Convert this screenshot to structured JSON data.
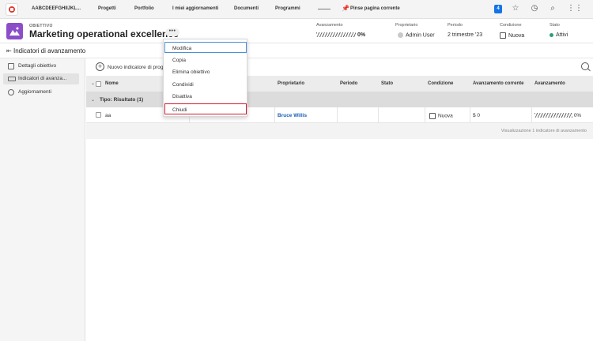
{
  "topnav": {
    "org": "AABCDEEFGHIIJKL...",
    "items": [
      "Progetti",
      "Portfolio",
      "I miei aggiornamenti",
      "Documenti",
      "Programmi"
    ],
    "pin_label": "Pinse pagina corrente",
    "badge": "4"
  },
  "header": {
    "label": "OBIETTIVO",
    "title": "Marketing operational excellence",
    "more": "•••",
    "avanzamento_label": "Avanzamento",
    "avanzamento_value": "0%",
    "proprietario_label": "Proprietario",
    "proprietario_value": "Admin User",
    "periodo_label": "Periodo",
    "periodo_value": "2 trimestre '23",
    "condizione_label": "Condizione",
    "condizione_value": "Nuova",
    "stato_label": "Stato",
    "stato_value": "Attivi"
  },
  "subheader": {
    "title": "Indicatori di avanzamento"
  },
  "sidebar": {
    "items": [
      {
        "label": "Dettagli obiettivo"
      },
      {
        "label": "Indicatori di avanza..."
      },
      {
        "label": "Aggiornamenti"
      }
    ]
  },
  "toolbar": {
    "add_label": "Nuovo indicatore di progr..."
  },
  "table": {
    "columns": [
      "Nome",
      "Proprietario",
      "Periodo",
      "Stato",
      "Condizione",
      "Avanzamento corrente",
      "Avanzamento"
    ],
    "group": "Tipo: Risultato (1)",
    "row": {
      "name": "aa",
      "owner": "Bruce Willis",
      "condition": "Nuova",
      "current": "$ 0",
      "progress": "0%"
    },
    "footer": "Visualizzazione 1 indicatore di avanzamento"
  },
  "menu": {
    "items": [
      "Modifica",
      "Copia",
      "Elimina obiettivo",
      "Condividi",
      "Disattiva",
      "Chiudi"
    ]
  }
}
